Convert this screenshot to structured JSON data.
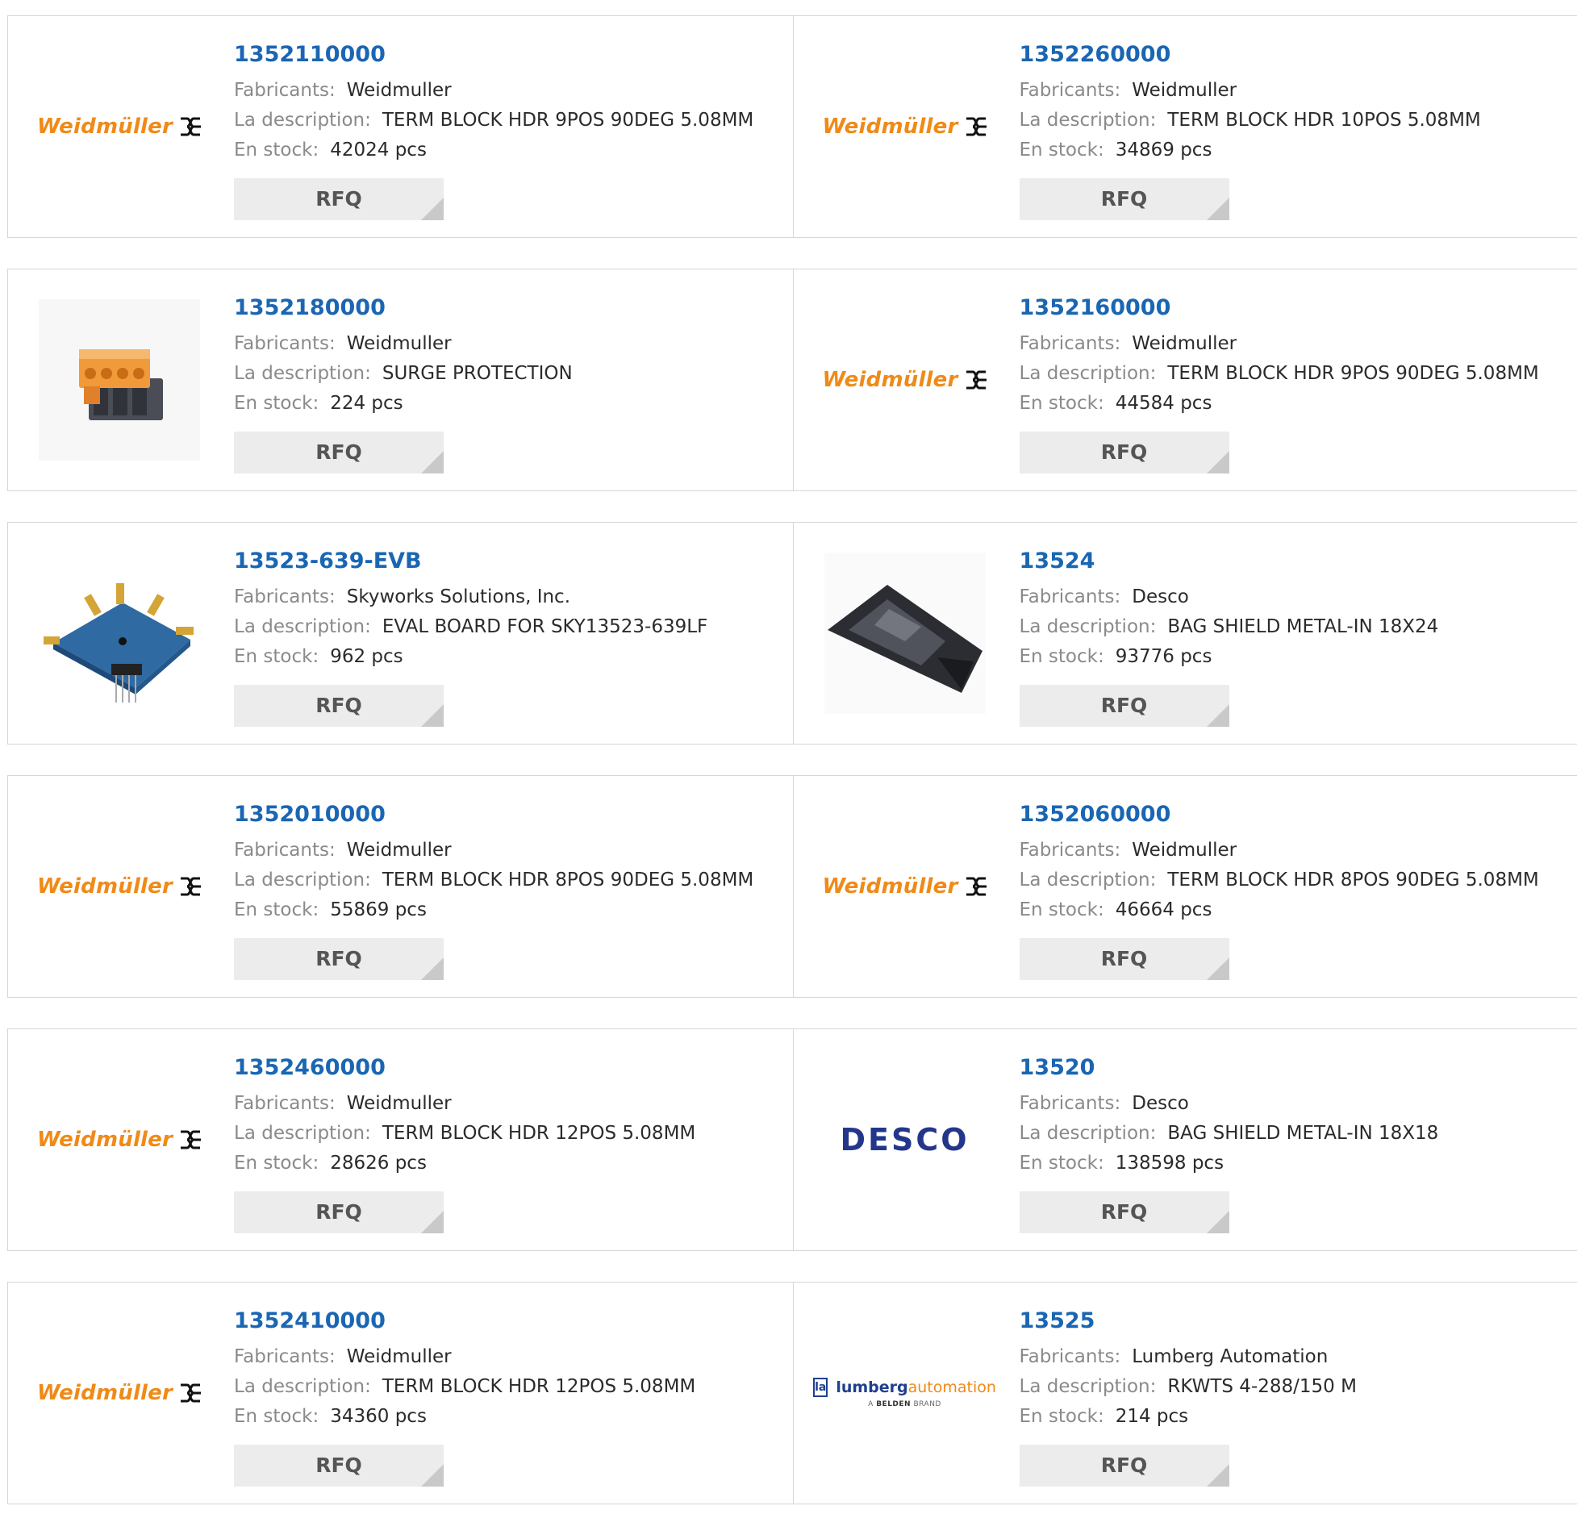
{
  "labels": {
    "manufacturer": "Fabricants:",
    "description": "La description:",
    "stock": "En stock:",
    "rfq": "RFQ"
  },
  "brand_logos": {
    "weidmuller": "Weidmüller",
    "desco": "DESCO",
    "lumberg_word1": "lumberg",
    "lumberg_word2": "automation",
    "lumberg_tag_a": "A",
    "lumberg_tag_b": "BELDEN",
    "lumberg_tag_c": "BRAND"
  },
  "colors": {
    "link": "#1a66b3",
    "brand_orange": "#f08a17",
    "desco_blue": "#24368a"
  },
  "rows": [
    {
      "items": [
        {
          "part": "1352110000",
          "manufacturer": "Weidmuller",
          "description": "TERM BLOCK HDR 9POS 90DEG 5.08MM",
          "stock": "42024 pcs",
          "image": "weidmuller-logo"
        },
        {
          "part": "1352260000",
          "manufacturer": "Weidmuller",
          "description": "TERM BLOCK HDR 10POS 5.08MM",
          "stock": "34869 pcs",
          "image": "weidmuller-logo"
        }
      ]
    },
    {
      "items": [
        {
          "part": "1352180000",
          "manufacturer": "Weidmuller",
          "description": "SURGE PROTECTION",
          "stock": "224 pcs",
          "image": "terminal-block-photo"
        },
        {
          "part": "1352160000",
          "manufacturer": "Weidmuller",
          "description": "TERM BLOCK HDR 9POS 90DEG 5.08MM",
          "stock": "44584 pcs",
          "image": "weidmuller-logo"
        }
      ]
    },
    {
      "items": [
        {
          "part": "13523-639-EVB",
          "manufacturer": "Skyworks Solutions, Inc.",
          "description": "EVAL BOARD FOR SKY13523-639LF",
          "stock": "962 pcs",
          "image": "eval-board-photo"
        },
        {
          "part": "13524",
          "manufacturer": "Desco",
          "description": "BAG SHIELD METAL-IN 18X24",
          "stock": "93776 pcs",
          "image": "shield-bag-photo"
        }
      ]
    },
    {
      "items": [
        {
          "part": "1352010000",
          "manufacturer": "Weidmuller",
          "description": "TERM BLOCK HDR 8POS 90DEG 5.08MM",
          "stock": "55869 pcs",
          "image": "weidmuller-logo"
        },
        {
          "part": "1352060000",
          "manufacturer": "Weidmuller",
          "description": "TERM BLOCK HDR 8POS 90DEG 5.08MM",
          "stock": "46664 pcs",
          "image": "weidmuller-logo"
        }
      ]
    },
    {
      "items": [
        {
          "part": "1352460000",
          "manufacturer": "Weidmuller",
          "description": "TERM BLOCK HDR 12POS 5.08MM",
          "stock": "28626 pcs",
          "image": "weidmuller-logo"
        },
        {
          "part": "13520",
          "manufacturer": "Desco",
          "description": "BAG SHIELD METAL-IN 18X18",
          "stock": "138598 pcs",
          "image": "desco-logo"
        }
      ]
    },
    {
      "items": [
        {
          "part": "1352410000",
          "manufacturer": "Weidmuller",
          "description": "TERM BLOCK HDR 12POS 5.08MM",
          "stock": "34360 pcs",
          "image": "weidmuller-logo"
        },
        {
          "part": "13525",
          "manufacturer": "Lumberg Automation",
          "description": "RKWTS 4-288/150 M",
          "stock": "214 pcs",
          "image": "lumberg-logo"
        }
      ]
    }
  ]
}
